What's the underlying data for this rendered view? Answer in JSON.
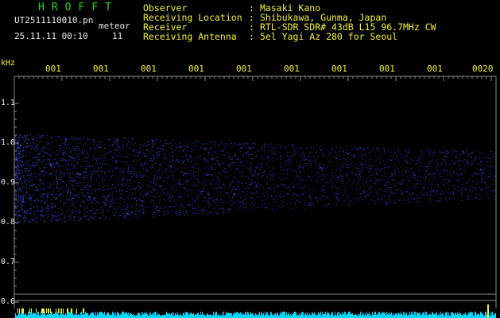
{
  "header": {
    "app_title": "HROFFT",
    "filename": "UT2511110010.pn",
    "tag": "meteor",
    "timestamp": "25.11.11 00:10",
    "extra": "11"
  },
  "info": [
    {
      "label": "Observer",
      "value": "Masaki Kano"
    },
    {
      "label": "Receiving Location",
      "value": "Shibukawa, Gunma, Japan"
    },
    {
      "label": "Receiver",
      "value": "RTL-SDR SDR# 43dB L15 96.7MHz CW"
    },
    {
      "label": "Receiving Antenna",
      "value": "5el Yagi Az 280 for Seoul"
    }
  ],
  "info_colon": ":",
  "axis": {
    "unit": "kHz",
    "y_ticks": [
      "1.1",
      "1.0",
      "0.9",
      "0.8",
      "0.7",
      "0.6"
    ],
    "x_ticks": [
      "001",
      "001",
      "001",
      "001",
      "001",
      "001",
      "001",
      "001",
      "001",
      "0020"
    ]
  },
  "colors": {
    "background": "#000000",
    "title": "#22d422",
    "info_text": "#f2f23a",
    "signal": "#2a40ff",
    "baseline": "#00e5ff"
  }
}
